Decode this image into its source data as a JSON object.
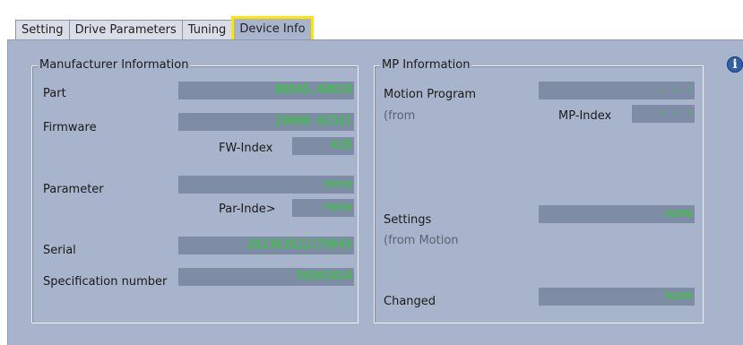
{
  "tabs": [
    {
      "label": "Setting"
    },
    {
      "label": "Drive Parameters"
    },
    {
      "label": "Tuning"
    },
    {
      "label": "Device Info"
    }
  ],
  "active_tab": "Device Info",
  "manufacturer": {
    "legend": "Manufacturer Information",
    "part_label": "Part",
    "part_value": "88565.04810",
    "firmware_label": "Firmware",
    "firmware_value": "29000.02321",
    "fw_index_label": "FW-Index",
    "fw_index_value": "025",
    "parameter_label": "Parameter",
    "parameter_value": "none",
    "par_index_label": "Par-Inde>",
    "par_index_value": "none",
    "serial_label": "Serial",
    "serial_value": "282383522179843",
    "spec_label": "Specification number",
    "spec_value": "56501024"
  },
  "mp": {
    "legend": "MP Information",
    "motion_program_label": "Motion Program",
    "motion_program_value": "- - -",
    "from_label": "(from",
    "mp_index_label": "MP-Index",
    "mp_index_value": "- - -",
    "settings_label": "Settings",
    "settings_value": "none",
    "from_motion_label": "(from Motion",
    "changed_label": "Changed",
    "changed_value": "none"
  },
  "colors": {
    "panel_bg": "#a8b4cc",
    "field_bg": "#7f8ca5",
    "field_text": "#27d427",
    "active_tab_outline": "#ffe600"
  },
  "icons": {
    "info": "info-icon"
  }
}
